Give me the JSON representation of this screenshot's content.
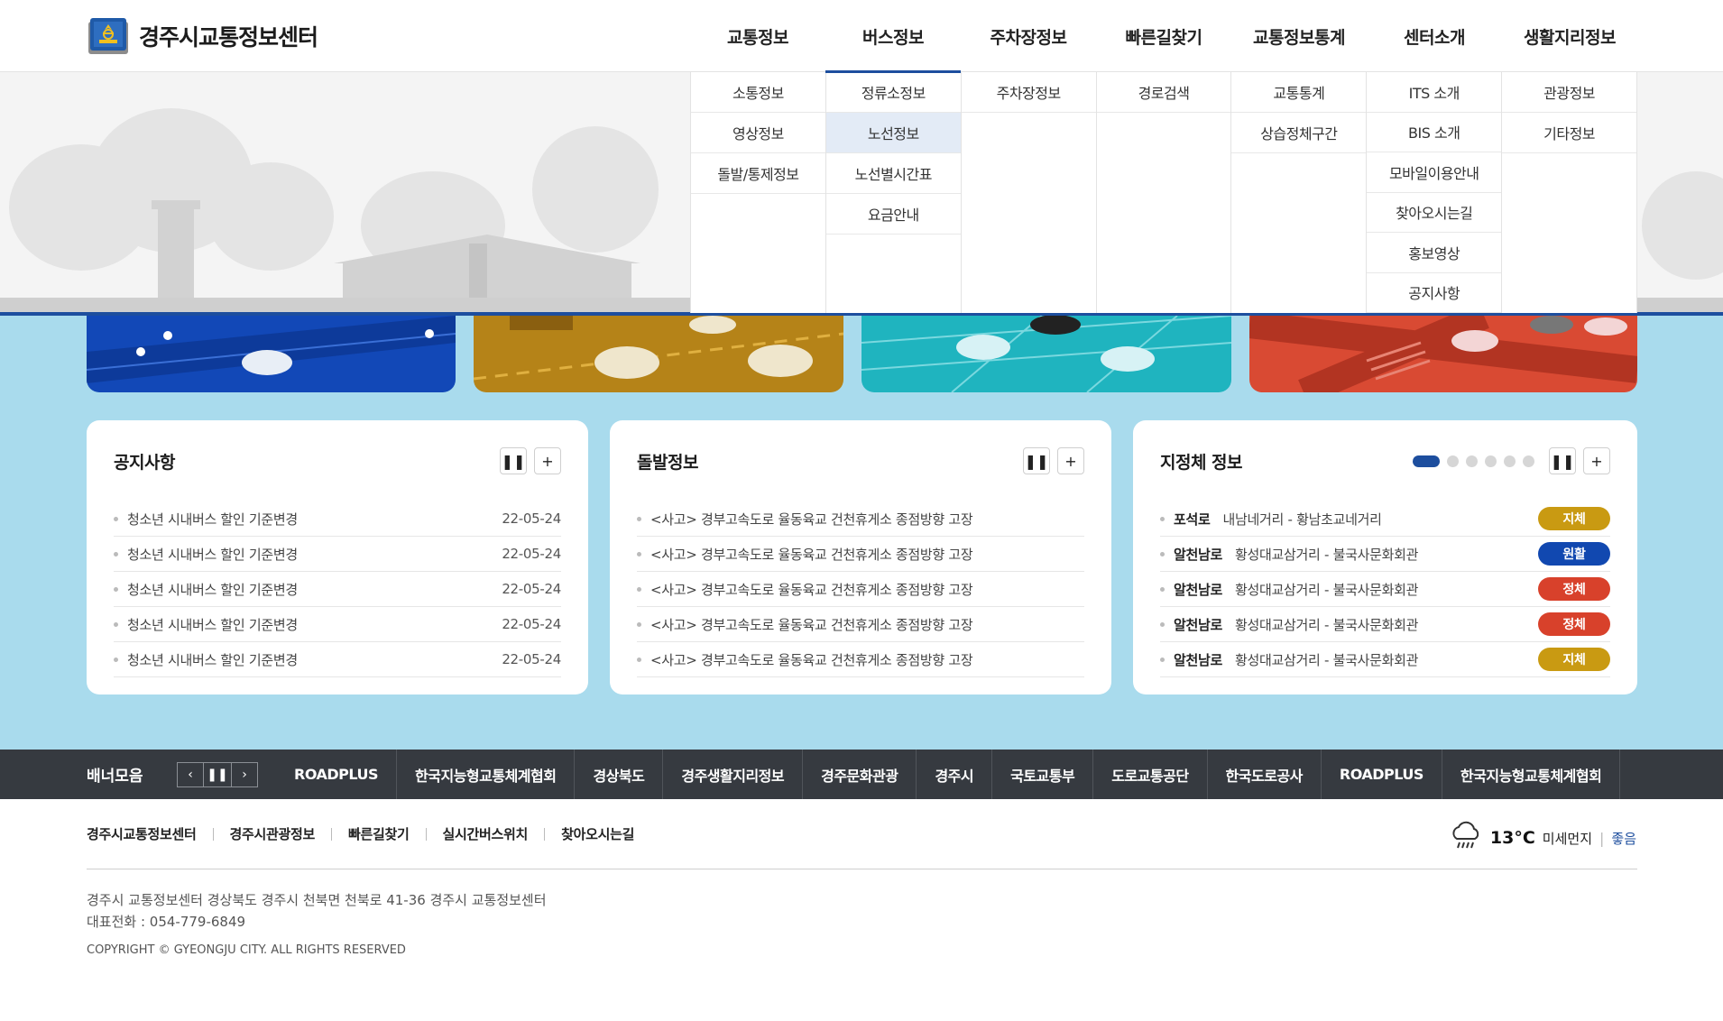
{
  "site": {
    "name": "경주시교통정보센터"
  },
  "gnb": [
    {
      "label": "교통정보"
    },
    {
      "label": "버스정보",
      "active": true
    },
    {
      "label": "주차장정보"
    },
    {
      "label": "빠른길찾기"
    },
    {
      "label": "교통정보통계"
    },
    {
      "label": "센터소개"
    },
    {
      "label": "생활지리정보"
    }
  ],
  "mega": [
    [
      "소통정보",
      "영상정보",
      "돌발/통제정보"
    ],
    [
      "정류소정보",
      "노선정보",
      "노선별시간표",
      "요금안내"
    ],
    [
      "주차장정보"
    ],
    [
      "경로검색"
    ],
    [
      "교통통계",
      "상습정체구간"
    ],
    [
      "ITS 소개",
      "BIS 소개",
      "모바일이용안내",
      "찾아오시는길",
      "홍보영상",
      "공지사항"
    ],
    [
      "관광정보",
      "기타정보"
    ]
  ],
  "notice": {
    "title": "공지사항",
    "items": [
      {
        "text": "청소년 시내버스 할인 기준변경",
        "date": "22-05-24"
      },
      {
        "text": "청소년 시내버스 할인 기준변경",
        "date": "22-05-24"
      },
      {
        "text": "청소년 시내버스 할인 기준변경",
        "date": "22-05-24"
      },
      {
        "text": "청소년 시내버스 할인 기준변경",
        "date": "22-05-24"
      },
      {
        "text": "청소년 시내버스 할인 기준변경",
        "date": "22-05-24"
      }
    ]
  },
  "incident": {
    "title": "돌발정보",
    "items": [
      "<사고> 경부고속도로 율동육교 건천휴게소 종점방향 고장",
      "<사고> 경부고속도로 율동육교 건천휴게소 종점방향 고장",
      "<사고> 경부고속도로 율동육교 건천휴게소 종점방향 고장",
      "<사고> 경부고속도로 율동육교 건천휴게소 종점방향 고장",
      "<사고> 경부고속도로 율동육교 건천휴게소 종점방향 고장"
    ]
  },
  "jam": {
    "title": "지정체 정보",
    "items": [
      {
        "road": "포석로",
        "section": "내남네거리 - 황남초교네거리",
        "status": "지체",
        "color": "#c99a12"
      },
      {
        "road": "알천남로",
        "section": "황성대교삼거리 - 불국사문화회관",
        "status": "원활",
        "color": "#1148b0"
      },
      {
        "road": "알천남로",
        "section": "황성대교삼거리 - 불국사문화회관",
        "status": "정체",
        "color": "#d8412b"
      },
      {
        "road": "알천남로",
        "section": "황성대교삼거리 - 불국사문화회관",
        "status": "정체",
        "color": "#d8412b"
      },
      {
        "road": "알천남로",
        "section": "황성대교삼거리 - 불국사문화회관",
        "status": "지체",
        "color": "#c99a12"
      }
    ]
  },
  "banner": {
    "title": "배너모음",
    "items": [
      "ROADPLUS",
      "한국지능형교통체계협회",
      "경상북도",
      "경주생활지리정보",
      "경주문화관광",
      "경주시",
      "국토교통부",
      "도로교통공단",
      "한국도로공사",
      "ROADPLUS",
      "한국지능형교통체계협회"
    ]
  },
  "footer": {
    "links": [
      "경주시교통정보센터",
      "경주시관광정보",
      "빠른길찾기",
      "실시간버스위치",
      "찾아오시는길"
    ],
    "address": "경주시 교통정보센터 경상북도 경주시 천북면 천북로 41-36 경주시 교통정보센터",
    "phone": "대표전화 : 054-779-6849",
    "copyright": "COPYRIGHT © GYEONGJU CITY. ALL RIGHTS RESERVED",
    "weather": {
      "icon": "rain-cloud-icon",
      "temp": "13°C",
      "dust_label": "미세먼지",
      "dust_value": "좋음"
    }
  },
  "colors": {
    "accent": "#1d4e9e",
    "content_bg": "#a9dbed",
    "banner_bg": "#363a40"
  }
}
